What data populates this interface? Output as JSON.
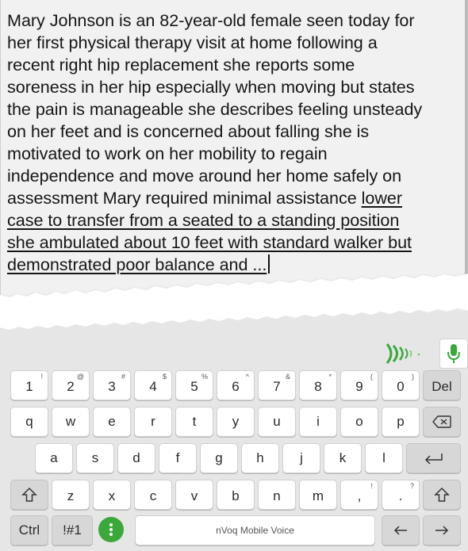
{
  "note": {
    "lines": [
      "Mary Johnson is an 82-year-old female seen today for",
      "her first physical therapy visit at home following a",
      "recent right hip replacement she reports some",
      "soreness in her hip especially when moving but states",
      "the pain is manageable she describes feeling unsteady",
      "on her feet and is concerned about falling she is",
      "motivated to work on her mobility to regain",
      "independence and move around her home safely on"
    ],
    "line9_plain": "assessment Mary required minimal assistance ",
    "line9_underlined": "lower",
    "underlined_lines": [
      "case to transfer from a seated to a standing position",
      "she ambulated about 10 feet with standard walker but",
      "demonstrated poor balance and ..."
    ]
  },
  "keyboard": {
    "voice_indicator_icon": "voice-waves-icon",
    "mic_icon": "microphone-icon",
    "accent_color": "#4caf50",
    "row1": [
      {
        "main": "1",
        "sub": "!"
      },
      {
        "main": "2",
        "sub": "@"
      },
      {
        "main": "3",
        "sub": "#"
      },
      {
        "main": "4",
        "sub": "$"
      },
      {
        "main": "5",
        "sub": "%"
      },
      {
        "main": "6",
        "sub": "^"
      },
      {
        "main": "7",
        "sub": "&"
      },
      {
        "main": "8",
        "sub": "*"
      },
      {
        "main": "9",
        "sub": "("
      },
      {
        "main": "0",
        "sub": ")"
      },
      {
        "main": "Del",
        "sub": ""
      }
    ],
    "row2": [
      "q",
      "w",
      "e",
      "r",
      "t",
      "y",
      "u",
      "i",
      "o",
      "p"
    ],
    "row3": [
      "a",
      "s",
      "d",
      "f",
      "g",
      "h",
      "j",
      "k",
      "l"
    ],
    "row4": [
      {
        "main": "z",
        "sub": ""
      },
      {
        "main": "x",
        "sub": ""
      },
      {
        "main": "c",
        "sub": ""
      },
      {
        "main": "v",
        "sub": ""
      },
      {
        "main": "b",
        "sub": ""
      },
      {
        "main": "n",
        "sub": ""
      },
      {
        "main": "m",
        "sub": ""
      },
      {
        "main": ",",
        "sub": "!"
      },
      {
        "main": ".",
        "sub": "?"
      }
    ],
    "row5": {
      "ctrl": "Ctrl",
      "symbols": "!#1",
      "space": "nVoq Mobile Voice"
    }
  }
}
